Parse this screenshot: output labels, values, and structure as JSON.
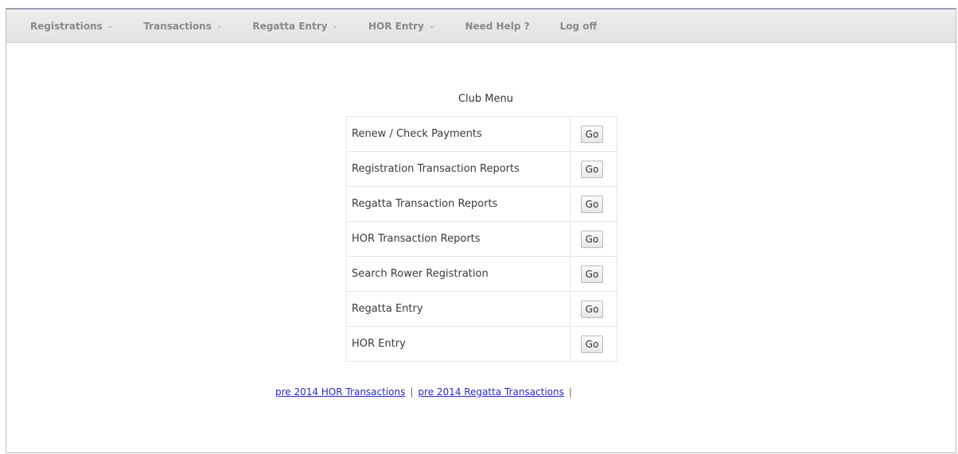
{
  "nav": {
    "items": [
      {
        "label": "Registrations",
        "dropdown": true
      },
      {
        "label": "Transactions",
        "dropdown": true
      },
      {
        "label": "Regatta Entry",
        "dropdown": true
      },
      {
        "label": "HOR Entry",
        "dropdown": true
      },
      {
        "label": "Need Help ?",
        "dropdown": false
      },
      {
        "label": "Log off",
        "dropdown": false
      }
    ],
    "caret": "⌄"
  },
  "menu": {
    "title": "Club Menu",
    "rows": [
      {
        "label": "Renew / Check Payments",
        "button": "Go"
      },
      {
        "label": "Registration Transaction Reports",
        "button": "Go"
      },
      {
        "label": "Regatta Transaction Reports",
        "button": "Go"
      },
      {
        "label": "HOR Transaction Reports",
        "button": "Go"
      },
      {
        "label": "Search Rower Registration",
        "button": "Go"
      },
      {
        "label": "Regatta Entry",
        "button": "Go"
      },
      {
        "label": "HOR Entry",
        "button": "Go"
      }
    ]
  },
  "footer_links": {
    "hor_link": "pre 2014 HOR Transactions",
    "regatta_link": "pre 2014 Regatta Transactions",
    "separator": "|"
  },
  "colors": {
    "link": "#2a2acc",
    "nav_text": "#8a8a8a",
    "nav_bg": "#e8e8e8"
  }
}
